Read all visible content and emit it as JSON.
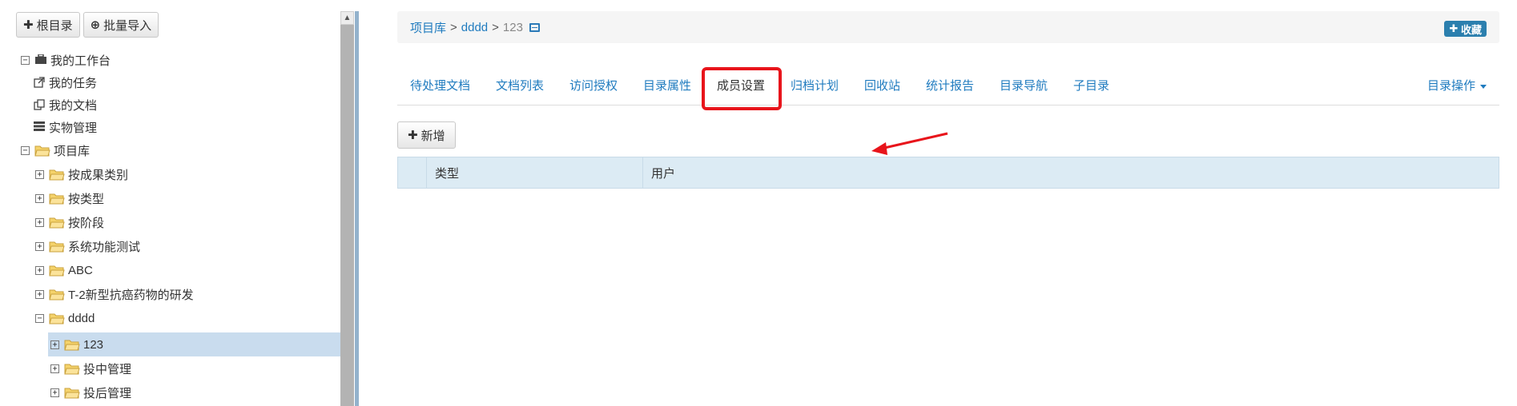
{
  "toolbar": {
    "root_dir_label": "根目录",
    "batch_import_label": "批量导入"
  },
  "tree": {
    "workspace": "我的工作台",
    "my_tasks": "我的任务",
    "my_docs": "我的文档",
    "physical_mgmt": "实物管理",
    "project_lib": "项目库",
    "by_result_type": "按成果类别",
    "by_type": "按类型",
    "by_stage": "按阶段",
    "sys_func_test": "系统功能测试",
    "abc": "ABC",
    "t2_research": "T-2新型抗癌药物的研发",
    "dddd": "dddd",
    "n123": "123",
    "mid_invest": "投中管理",
    "post_invest": "投后管理"
  },
  "breadcrumb": {
    "item1": "项目库",
    "item2": "dddd",
    "current": "123",
    "sep": ">"
  },
  "favorite_label": "收藏",
  "tabs": [
    {
      "label": "待处理文档"
    },
    {
      "label": "文档列表"
    },
    {
      "label": "访问授权"
    },
    {
      "label": "目录属性"
    },
    {
      "label": "成员设置"
    },
    {
      "label": "归档计划"
    },
    {
      "label": "回收站"
    },
    {
      "label": "统计报告"
    },
    {
      "label": "目录导航"
    },
    {
      "label": "子目录"
    }
  ],
  "active_tab": "成员设置",
  "dir_ops_label": "目录操作",
  "add_label": "新增",
  "grid": {
    "col_type": "类型",
    "col_user": "用户"
  },
  "colors": {
    "link": "#1f7bbf",
    "highlight_box": "#e8141b",
    "selected_row": "#c9dcee",
    "grid_header": "#dcebf4",
    "fav_button": "#2b7fae"
  }
}
